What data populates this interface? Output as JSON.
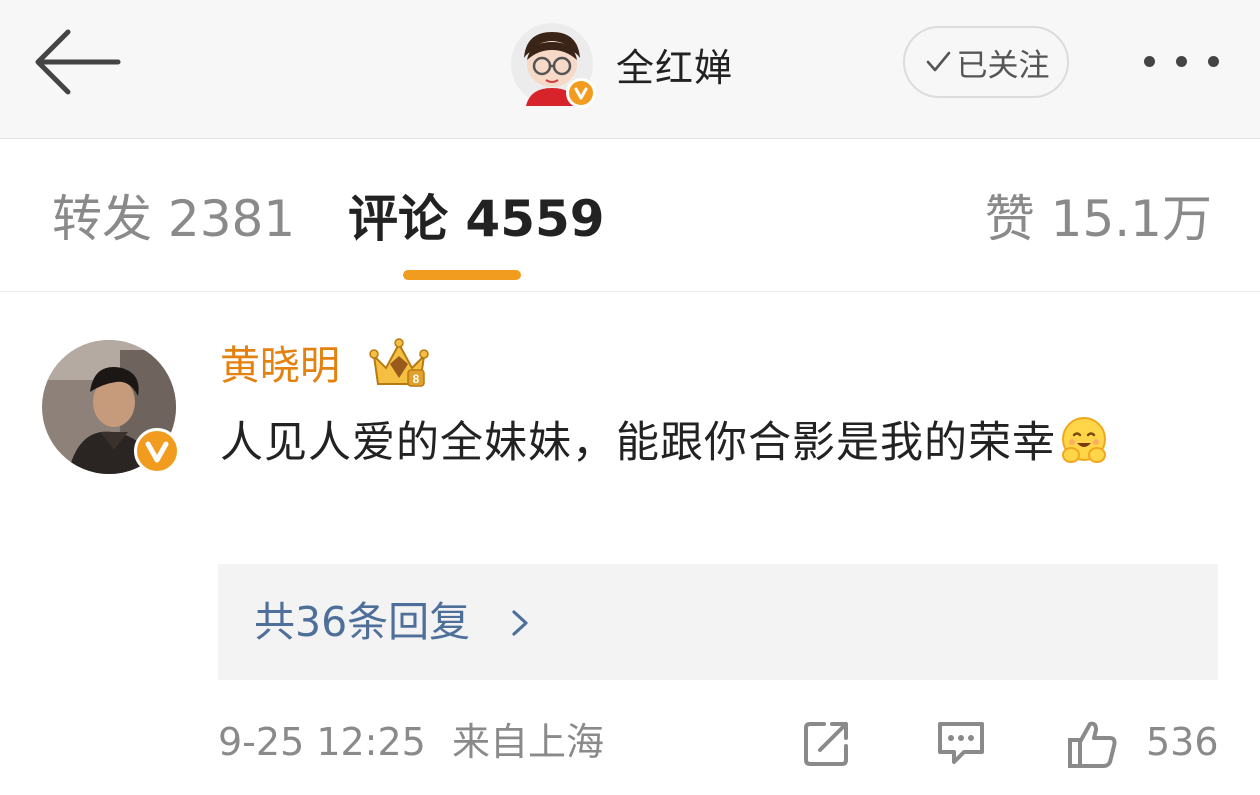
{
  "header": {
    "author_name": "全红婵",
    "follow_label": "已关注"
  },
  "tabs": {
    "repost": "转发 2381",
    "comment": "评论 4559",
    "like": "赞 15.1万"
  },
  "comment": {
    "user_name": "黄晓明",
    "text": "人见人爱的全妹妹，能跟你合影是我的荣幸",
    "replies_label": "共36条回复",
    "time": "9-25 12:25",
    "location": "来自上海",
    "like_count": "536"
  },
  "icons": {
    "back": "arrow-left-icon",
    "verified": "verified-v-icon",
    "follow_check": "check-icon",
    "more": "more-dots-icon",
    "crown": "crown-badge-icon",
    "emoji": "hug-emoji-icon",
    "chevron": "chevron-right-icon",
    "share": "share-icon",
    "reply": "comment-icon",
    "like": "thumb-up-icon"
  },
  "colors": {
    "accent": "#f29c1f",
    "username": "#e5810f",
    "reply_link": "#4e6f9a",
    "muted": "#8a8a8a"
  }
}
